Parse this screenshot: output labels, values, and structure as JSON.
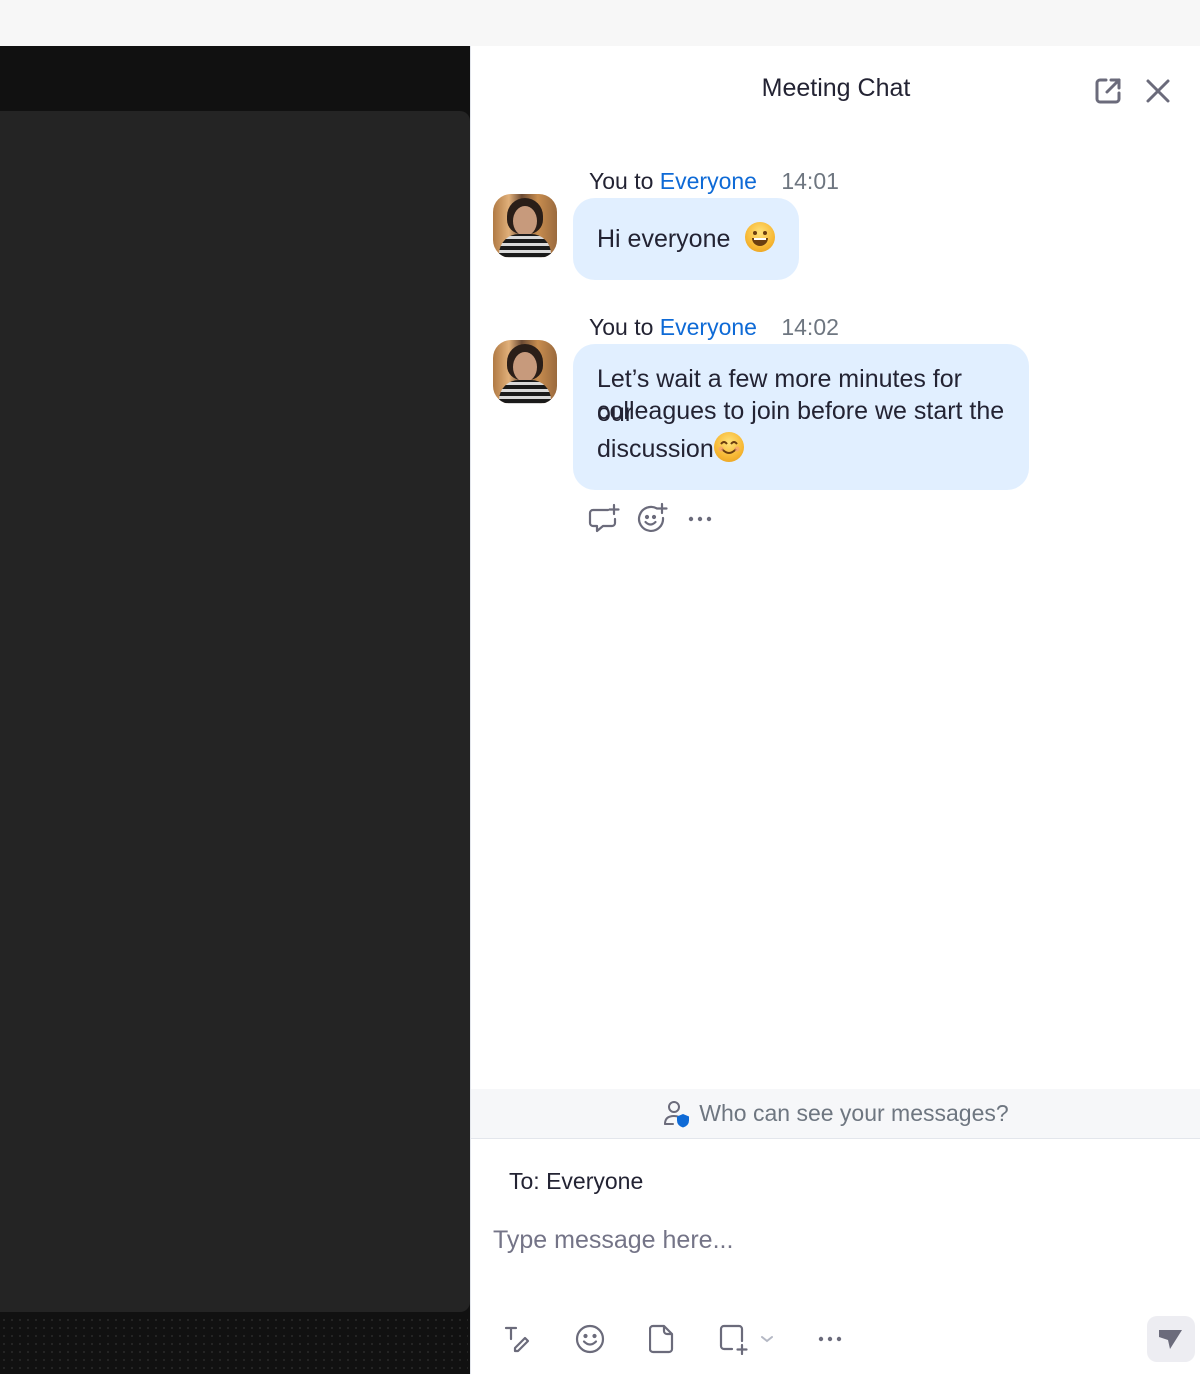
{
  "chat": {
    "title": "Meeting Chat",
    "header_icons": [
      "pop-out-icon",
      "close-icon"
    ],
    "messages": [
      {
        "sender": "You",
        "to_word": "to",
        "recipient": "Everyone",
        "time": "14:01",
        "text": "Hi everyone",
        "emoji": "grinning-face"
      },
      {
        "sender": "You",
        "to_word": "to",
        "recipient": "Everyone",
        "time": "14:02",
        "lines": [
          "Let’s wait a few more minutes for our",
          "colleagues to join before we start the",
          "discussion"
        ],
        "emoji": "smiling-face-with-smiling-eyes"
      }
    ],
    "message_actions": [
      "reply-icon",
      "add-reaction-icon",
      "more-icon"
    ],
    "privacy_prompt": "Who can see your messages?",
    "to_label": "To:",
    "to_value": "Everyone",
    "input_placeholder": "Type message here...",
    "input_value": "",
    "composer_tools": [
      "format-text-icon",
      "emoji-icon",
      "file-icon",
      "screenshot-icon",
      "chevron-down-icon",
      "more-icon"
    ],
    "send_icon": "send-icon",
    "colors": {
      "accent": "#0e6ad6",
      "bubble": "#e1efff",
      "text": "#232333",
      "muted": "#6e7680"
    }
  }
}
